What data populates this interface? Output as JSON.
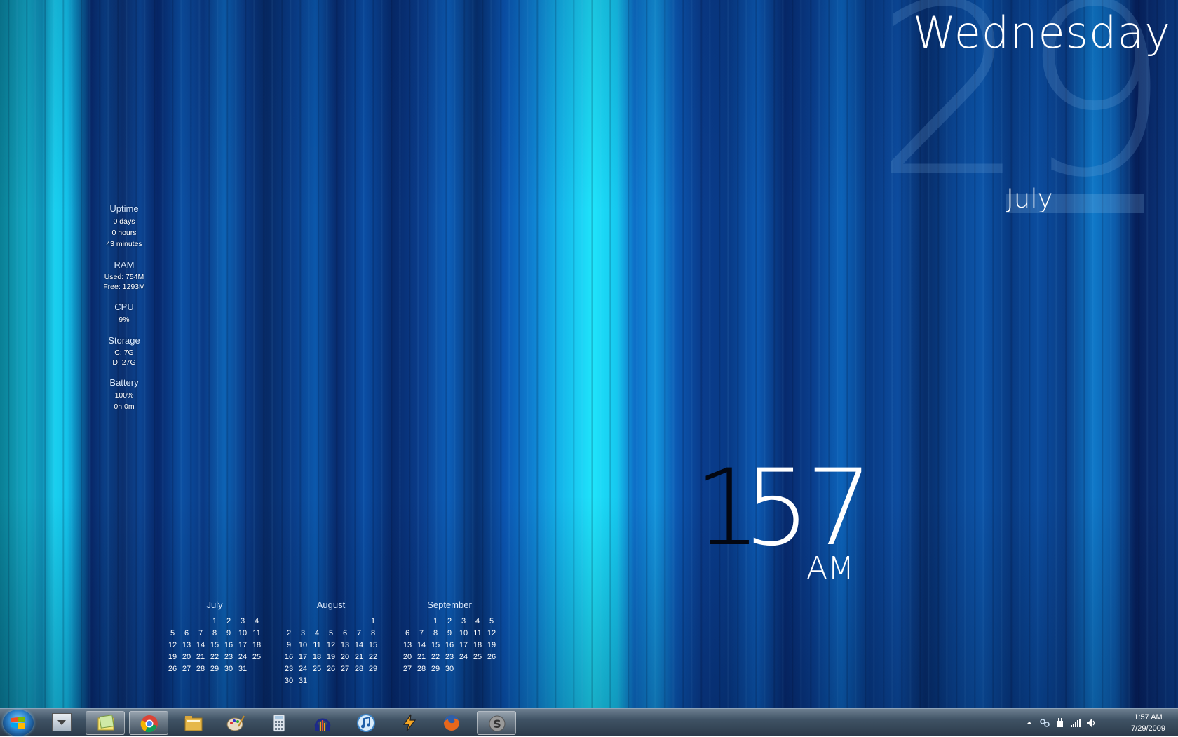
{
  "stats": {
    "uptime": {
      "heading": "Uptime",
      "days": "0 days",
      "hours": "0 hours",
      "minutes": "43 minutes"
    },
    "ram": {
      "heading": "RAM",
      "used": "Used: 754M",
      "free": "Free: 1293M"
    },
    "cpu": {
      "heading": "CPU",
      "value": "9%"
    },
    "storage": {
      "heading": "Storage",
      "c": "C: 7G",
      "d": "D: 27G"
    },
    "battery": {
      "heading": "Battery",
      "percent": "100%",
      "time": "0h 0m"
    }
  },
  "date_widget": {
    "weekday": "Wednesday",
    "day_number": "29",
    "month": "July"
  },
  "clock": {
    "hour": "1",
    "minutes": "57",
    "ampm": "AM"
  },
  "calendars": [
    {
      "title": "July",
      "lead_blanks": 3,
      "days": 31,
      "today": 29
    },
    {
      "title": "August",
      "lead_blanks": 6,
      "days": 31,
      "today": null
    },
    {
      "title": "September",
      "lead_blanks": 2,
      "days": 30,
      "today": null
    }
  ],
  "taskbar": {
    "apps": [
      {
        "name": "show-desktop",
        "icon": "notes-icon"
      },
      {
        "name": "chrome",
        "icon": "chrome-icon"
      },
      {
        "name": "file-explorer",
        "icon": "folder-icon"
      },
      {
        "name": "paint",
        "icon": "paint-palette-icon"
      },
      {
        "name": "calculator",
        "icon": "calculator-icon"
      },
      {
        "name": "audio",
        "icon": "headphones-icon"
      },
      {
        "name": "itunes",
        "icon": "music-note-icon"
      },
      {
        "name": "winamp",
        "icon": "winamp-bolt-icon"
      },
      {
        "name": "firefox",
        "icon": "firefox-icon"
      },
      {
        "name": "steam",
        "icon": "s-logo-icon"
      }
    ],
    "tray_time": "1:57 AM",
    "tray_date": "7/29/2009"
  },
  "colors": {
    "accent_cyan": "#1fe4fb",
    "deep_blue": "#08286a",
    "clock_hour_color": "#030712"
  }
}
